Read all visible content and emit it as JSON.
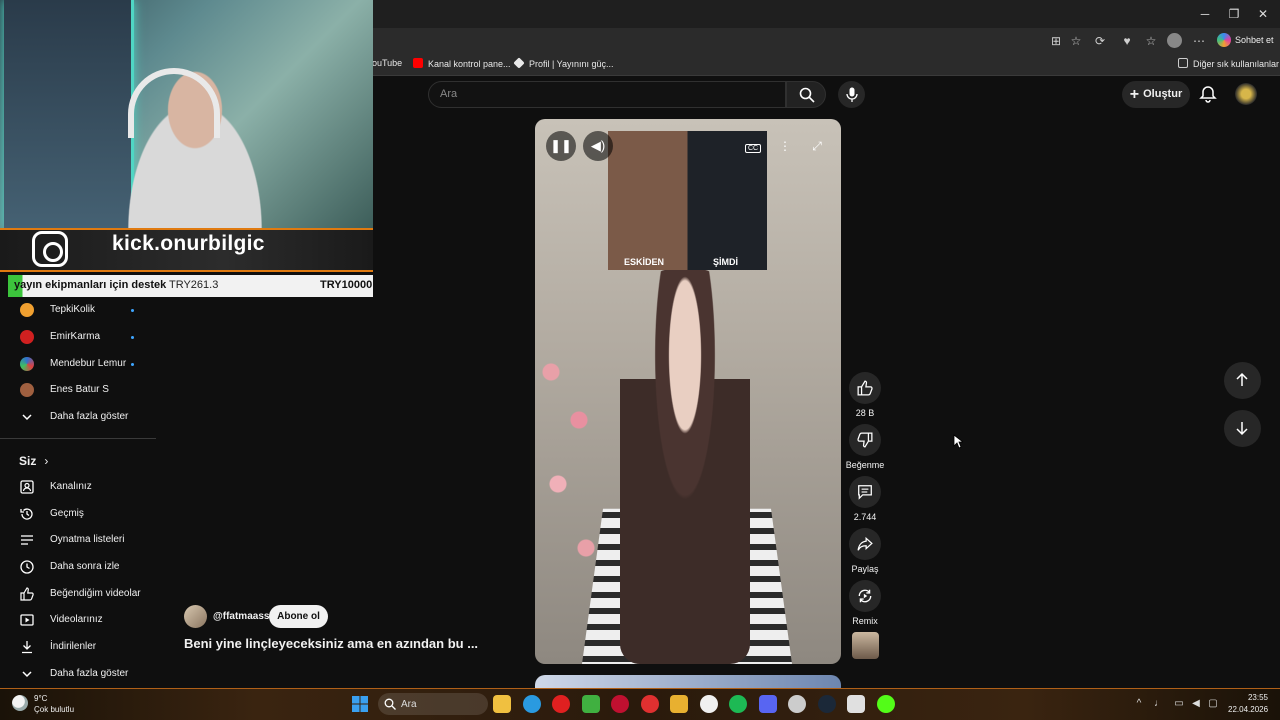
{
  "browser": {
    "copilot_label": "Sohbet et",
    "bookmarks": [
      {
        "label": "ouTube",
        "color": "#ff0000"
      },
      {
        "label": "Kanal kontrol pane...",
        "color": "#ff0000"
      },
      {
        "label": "Profil | Yayınını güç...",
        "color": "#e8e8e8"
      }
    ],
    "other_bookmarks": "Diğer sık kullanılanlar"
  },
  "header": {
    "search_placeholder": "Ara",
    "create_label": "Oluştur"
  },
  "overlay": {
    "kick_handle": "kick.onurbilgic",
    "donation_label": "yayın ekipmanları için destek",
    "donation_current": "TRY261.3",
    "donation_goal": "TRY10000",
    "donation_progress_fraction": 0.026
  },
  "sidebar": {
    "subscriptions": [
      {
        "label": "TepkiKolik",
        "icon_color": "#f0a030",
        "live": true
      },
      {
        "label": "EmirKarma",
        "icon_color": "#d02020",
        "live": true
      },
      {
        "label": "Mendebur Lemur",
        "icon_color": "#3070d0",
        "live": true
      },
      {
        "label": "Enes Batur S",
        "icon_color": "#a06040",
        "live": false
      }
    ],
    "show_more_subs": "Daha fazla göster",
    "you_heading": "Siz",
    "you_items": [
      {
        "label": "Kanalınız",
        "icon": "channel-icon"
      },
      {
        "label": "Geçmiş",
        "icon": "history-icon"
      },
      {
        "label": "Oynatma listeleri",
        "icon": "playlists-icon"
      },
      {
        "label": "Daha sonra izle",
        "icon": "watch-later-icon"
      },
      {
        "label": "Beğendiğim videolar",
        "icon": "liked-icon"
      },
      {
        "label": "Videolarınız",
        "icon": "your-videos-icon"
      },
      {
        "label": "İndirilenler",
        "icon": "download-icon"
      },
      {
        "label": "Daha fazla göster",
        "icon": "chevron-down-icon"
      }
    ]
  },
  "video": {
    "inset_left": "ESKİDEN",
    "inset_right": "ŞİMDİ",
    "channel": "@ffatmaass",
    "subscribe_label": "Abone ol",
    "title": "Beni yine linçleyeceksiniz ama en azından bu ..."
  },
  "actions": {
    "likes": "28 B",
    "dislike_label": "Beğenme",
    "comments": "2.744",
    "share_label": "Paylaş",
    "remix_label": "Remix"
  },
  "taskbar": {
    "temperature": "9°C",
    "weather": "Çok bulutlu",
    "search_label": "Ara",
    "time": "23:55",
    "date": "22.04.2026",
    "apps": [
      {
        "icon": "file-explorer-icon",
        "color": "#f0c040"
      },
      {
        "icon": "edge-icon",
        "color": "#2a9ae0"
      },
      {
        "icon": "opera-icon",
        "color": "#e02020"
      },
      {
        "icon": "chrome-icon",
        "color": "#40b040"
      },
      {
        "icon": "opera-gx-icon",
        "color": "#c01030"
      },
      {
        "icon": "yandex-icon",
        "color": "#e03030"
      },
      {
        "icon": "folder-icon",
        "color": "#e8b030"
      },
      {
        "icon": "store-icon",
        "color": "#f0f0f0"
      },
      {
        "icon": "spotify-icon",
        "color": "#1db954"
      },
      {
        "icon": "discord-icon",
        "color": "#5865f2"
      },
      {
        "icon": "settings-icon",
        "color": "#cccccc"
      },
      {
        "icon": "steam-icon",
        "color": "#1b2838"
      },
      {
        "icon": "github-icon",
        "color": "#e0e0e0"
      },
      {
        "icon": "kick-icon",
        "color": "#53fc18"
      }
    ]
  }
}
